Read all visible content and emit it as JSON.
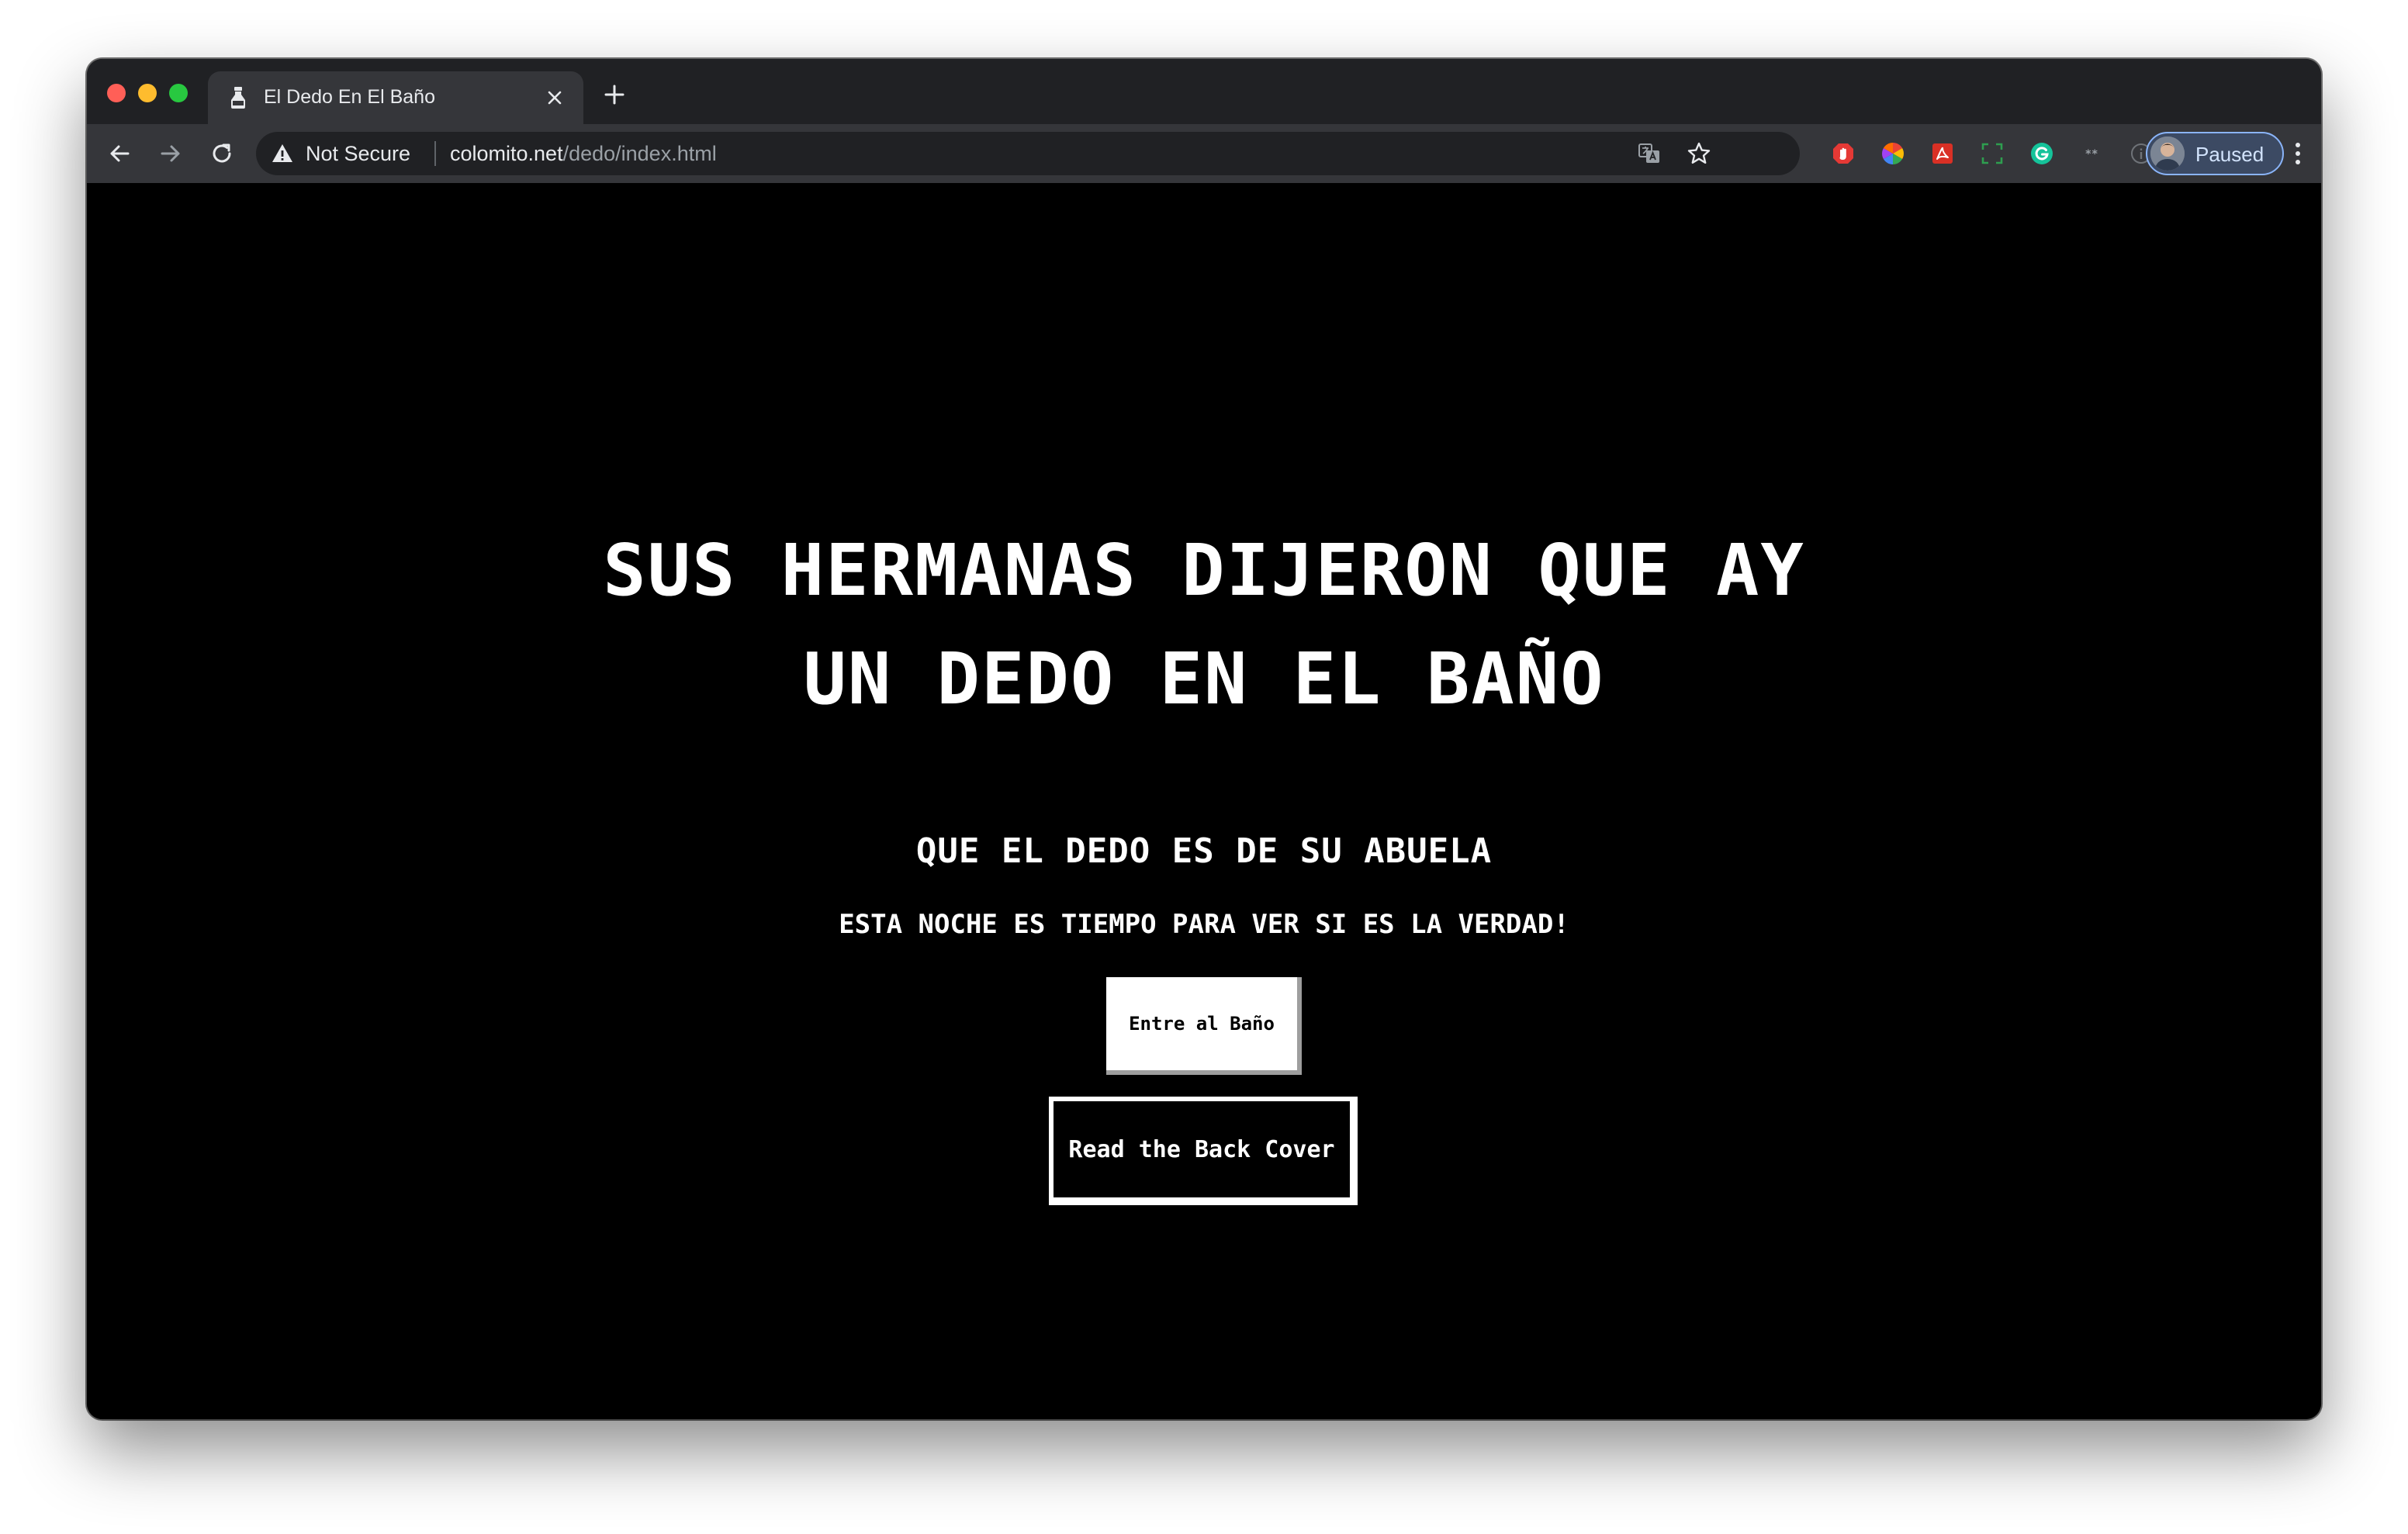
{
  "browser": {
    "tab": {
      "title": "El Dedo En El Baño",
      "favicon": "bottle-favicon-icon"
    },
    "address_bar": {
      "security_label": "Not Secure",
      "url_host": "colomito.net",
      "url_path": "/dedo/index.html"
    },
    "profile": {
      "label": "Paused"
    },
    "colors": {
      "tabstrip": "#202124",
      "toolbar": "#35363a",
      "omnibox": "#202124",
      "profile_border": "#8ab4f8"
    }
  },
  "page": {
    "heading_line1": "SUS HERMANAS DIJERON QUE AY",
    "heading_line2": "UN DEDO EN EL BAÑO",
    "subtitle": "QUE EL DEDO ES DE SU ABUELA",
    "tagline": "ESTA NOCHE ES TIEMPO PARA VER SI ES LA VERDAD!",
    "buttons": {
      "enter": "Entre al Baño",
      "back_cover": "Read the Back Cover"
    },
    "colors": {
      "background": "#000000",
      "text": "#ffffff"
    }
  }
}
